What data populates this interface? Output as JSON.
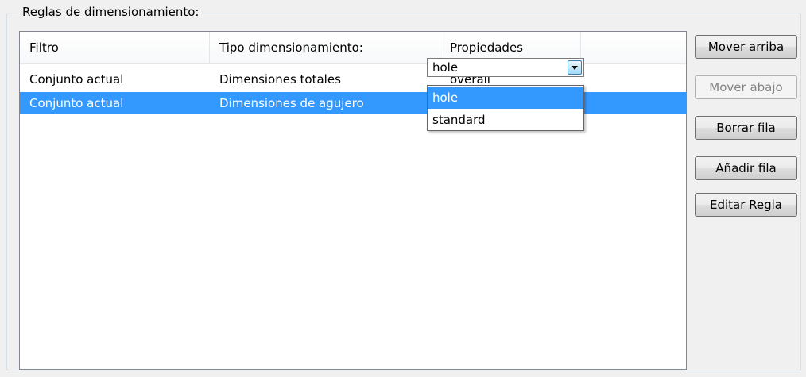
{
  "group": {
    "title": "Reglas de dimensionamiento:"
  },
  "table": {
    "columns": [
      "Filtro",
      "Tipo dimensionamiento:",
      "Propiedades"
    ],
    "rows": [
      {
        "filter": "Conjunto actual",
        "type": "Dimensiones totales",
        "property": "overall",
        "selected": false
      },
      {
        "filter": "Conjunto actual",
        "type": "Dimensiones de agujero",
        "property": "hole",
        "selected": true
      }
    ]
  },
  "combo": {
    "value": "hole",
    "options": [
      "hole",
      "standard"
    ],
    "highlighted": "hole"
  },
  "buttons": {
    "move_up": "Mover arriba",
    "move_down": "Mover abajo",
    "delete_row": "Borrar fila",
    "add_row": "Añadir fila",
    "edit_rule": "Editar Regla"
  },
  "colors": {
    "selection": "#3399ff",
    "background": "#f0f0f0"
  }
}
